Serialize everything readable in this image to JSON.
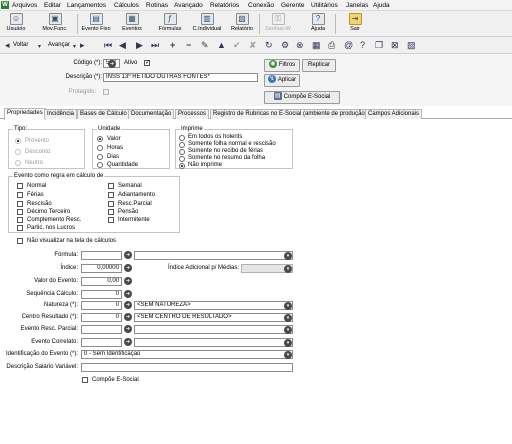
{
  "menu": [
    "Arquivos",
    "Editar",
    "Lançamentos",
    "Cálculos",
    "Rotinas",
    "Avançado",
    "Relatórios",
    "Conexão",
    "Gerente",
    "Utilitários",
    "Janelas",
    "Ajuda"
  ],
  "toolbar": {
    "usuario": "Usuário",
    "movfunc": "Mov.Func.",
    "eventofixo": "Evento Fixo",
    "eventos": "Eventos",
    "formulas": "Fórmulas",
    "cindividual": "C.Individual",
    "relatorio": "Relatório",
    "senhas": "Senhas-W",
    "ajuda": "Ajuda",
    "sair": "Sair"
  },
  "nav": {
    "voltar": "Voltar",
    "avancar": "Avançar"
  },
  "header": {
    "codigo_label": "Código (*):",
    "codigo_value": "502",
    "ativo_label": "Ativo",
    "descricao_label": "Descrição (*):",
    "descricao_value": "INSS 13º RETIDO OUTRAS FONTES*",
    "protegido_label": "Protegido:",
    "filtros": "Filtros",
    "replicar": "Replicar",
    "aplicar": "Aplicar",
    "compoe": "Compõe E-Social"
  },
  "tabs": [
    "Propriedades",
    "Incidência",
    "Bases de Cálculo",
    "Documentação",
    "Processos",
    "Registro de Rubricas no E-Social (ambiente de produção)",
    "Campos Adicionais"
  ],
  "tipo": {
    "title": "Tipo:",
    "options": [
      "Provento",
      "Desconto",
      "Neutro"
    ]
  },
  "unidade": {
    "title": "Unidade",
    "options": [
      "Valor",
      "Horas",
      "Dias",
      "Quantidade"
    ],
    "selected": "Valor"
  },
  "imprime": {
    "title": "Imprime",
    "options": [
      "Em todos os holerits",
      "Somente folha normal e rescisão",
      "Somente no recibo de férias",
      "Somente no resumo da folha",
      "Não imprime"
    ],
    "selected": "Não imprime"
  },
  "regra": {
    "title": "Evento como regra em cálculo de",
    "left": [
      "Normal",
      "Férias",
      "Rescisão",
      "Décimo Terceiro",
      "Complemento Resc.",
      "Partic. nos Lucros"
    ],
    "right": [
      "Semanal",
      "Adiantamento",
      "Resc.Parcial",
      "Pensão",
      "Intermitente"
    ]
  },
  "nao_visualizar": "Não visualizar na tela de cálculos",
  "form": {
    "formula": "Fórmula:",
    "indice": "Índice:",
    "indice_value": "0,00000",
    "indice_adicional": "Índice Adicional p/ Médias:",
    "valor_evento": "Valor do Evento:",
    "valor_evento_value": "0,00",
    "sequencia": "Sequência Cálculo:",
    "sequencia_value": "0",
    "natureza": "Natureza (*):",
    "natureza_value": "0",
    "natureza_desc": "<SEM NATUREZA>",
    "centro": "Centro Resultado (*):",
    "centro_value": "0",
    "centro_desc": "<SEM CENTRO DE RESULTADO>",
    "resc_parcial": "Evento Resc. Parcial:",
    "correlato": "Evento Correlato:",
    "identificacao": "Identificação do Evento (*):",
    "identificacao_value": "0 - Sem Identificação",
    "salario": "Descrição Salário Variável:",
    "compoe_social": "Compõe E-Social"
  }
}
